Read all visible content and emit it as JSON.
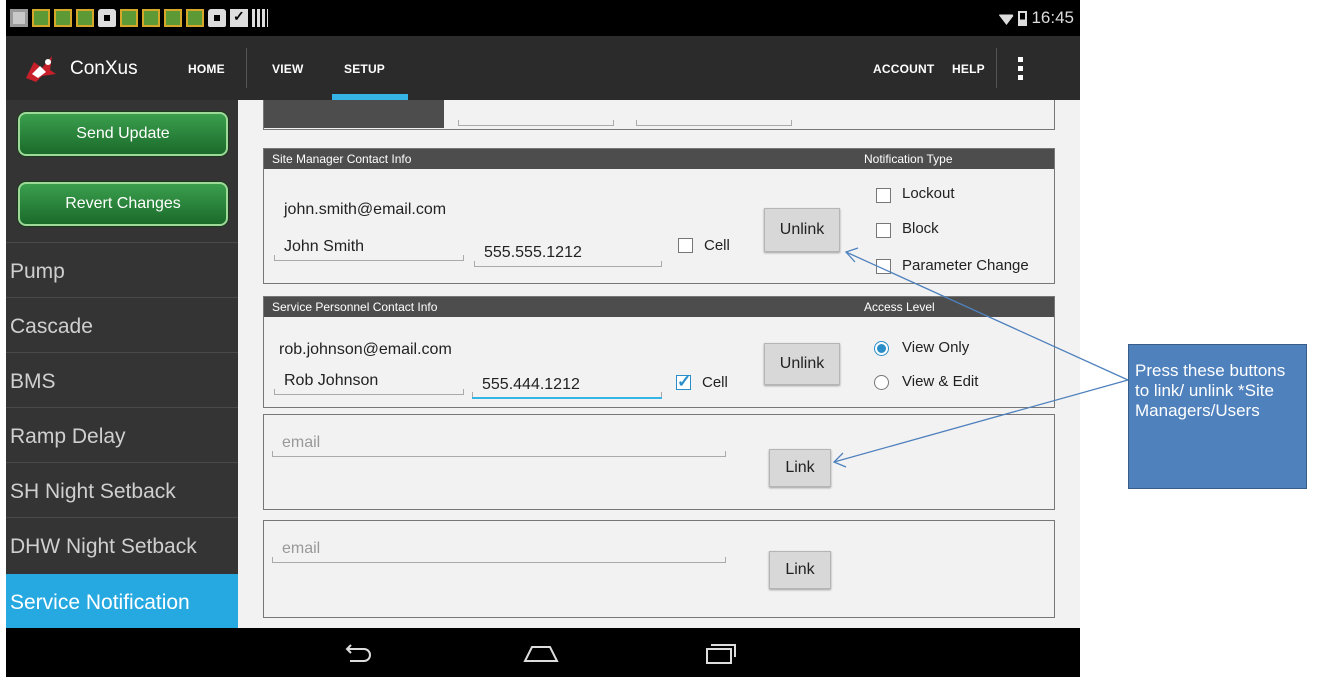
{
  "status_bar": {
    "time": "16:45"
  },
  "action_bar": {
    "app_title": "ConXus",
    "nav": {
      "home": "HOME",
      "view": "VIEW",
      "setup": "SETUP",
      "account": "ACCOUNT",
      "help": "HELP"
    },
    "active_tab": "SETUP"
  },
  "sidebar": {
    "send_update": "Send Update",
    "revert_changes": "Revert Changes",
    "items": [
      {
        "label": "Pump"
      },
      {
        "label": "Cascade"
      },
      {
        "label": "BMS"
      },
      {
        "label": "Ramp Delay"
      },
      {
        "label": "SH Night Setback"
      },
      {
        "label": "DHW Night Setback"
      },
      {
        "label": "Service Notification",
        "active": true
      }
    ]
  },
  "site_manager": {
    "header": "Site Manager Contact Info",
    "type_header": "Notification Type",
    "email": "john.smith@email.com",
    "name": "John Smith",
    "phone": "555.555.1212",
    "cell_label": "Cell",
    "cell_checked": false,
    "button": "Unlink",
    "options": [
      {
        "label": "Lockout",
        "checked": false
      },
      {
        "label": "Block",
        "checked": false
      },
      {
        "label": "Parameter Change",
        "checked": false
      }
    ]
  },
  "service_personnel": {
    "header": "Service Personnel Contact Info",
    "level_header": "Access Level",
    "email": "rob.johnson@email.com",
    "name": "Rob Johnson",
    "phone": "555.444.1212",
    "cell_label": "Cell",
    "cell_checked": true,
    "button": "Unlink",
    "options": [
      {
        "label": "View Only",
        "selected": true
      },
      {
        "label": "View & Edit",
        "selected": false
      }
    ]
  },
  "empty_slots": [
    {
      "email_placeholder": "email",
      "button": "Link"
    },
    {
      "email_placeholder": "email",
      "button": "Link"
    }
  ],
  "callout": {
    "text": "Press these buttons to link/ unlink *Site Managers/Users"
  },
  "colors": {
    "accent": "#34b5e5",
    "green_button": "#2e8b3e",
    "active_item": "#26a9e0",
    "callout": "#4f81bd"
  }
}
